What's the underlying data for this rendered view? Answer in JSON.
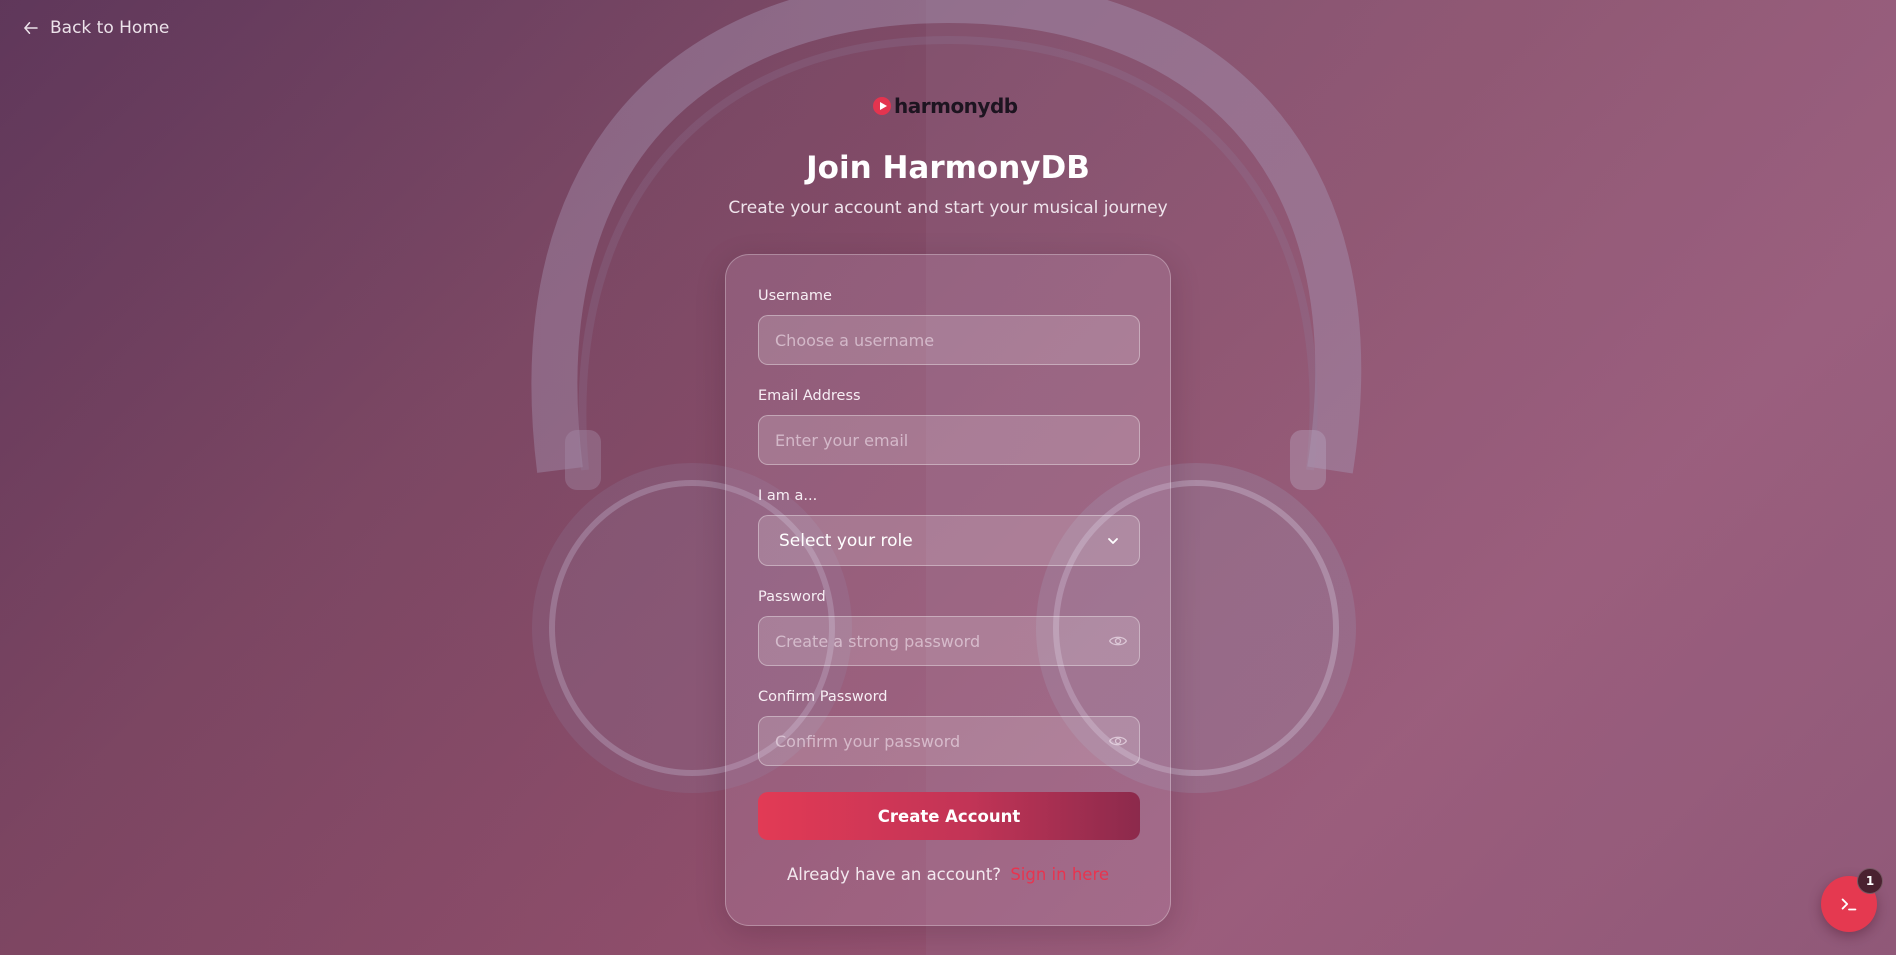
{
  "nav": {
    "back_label": "Back to Home"
  },
  "brand": {
    "logo_text": "harmonydb",
    "accent_color": "#e3344f"
  },
  "header": {
    "title": "Join HarmonyDB",
    "subtitle": "Create your account and start your musical journey"
  },
  "form": {
    "username": {
      "label": "Username",
      "value": "",
      "placeholder": "Choose a username"
    },
    "email": {
      "label": "Email Address",
      "value": "",
      "placeholder": "Enter your email"
    },
    "role": {
      "label": "I am a...",
      "selected": "Select your role"
    },
    "password": {
      "label": "Password",
      "value": "",
      "placeholder": "Create a strong password"
    },
    "confirm_password": {
      "label": "Confirm Password",
      "value": "",
      "placeholder": "Confirm your password"
    },
    "submit_label": "Create Account",
    "signin_prompt": "Already have an account?",
    "signin_link": "Sign in here"
  },
  "fab": {
    "icon": "terminal-icon",
    "badge_count": "1"
  }
}
